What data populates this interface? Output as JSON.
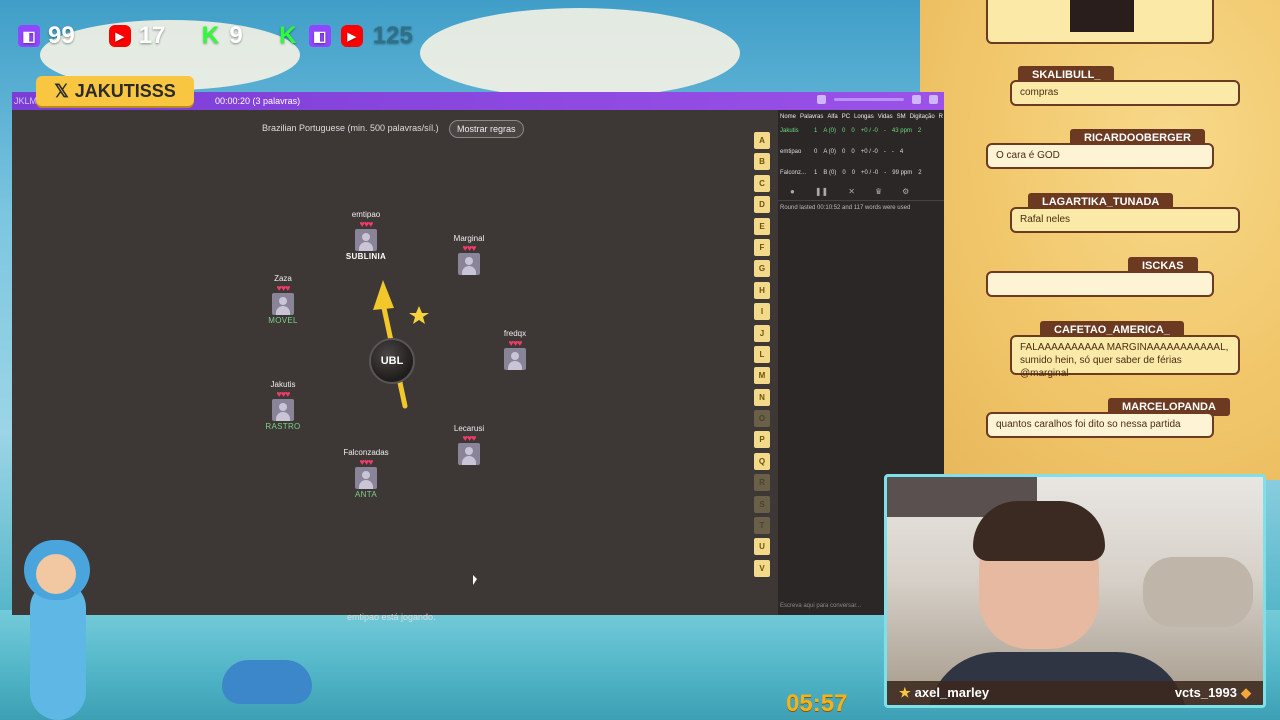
{
  "overlay": {
    "stats": [
      {
        "platform": "twitch-icon",
        "value": "99"
      },
      {
        "platform": "youtube-icon",
        "value": "17"
      },
      {
        "platform": "kick-icon",
        "value": "9"
      }
    ],
    "total": "125",
    "x_handle": "JAKUTISSS",
    "clock": "05:57"
  },
  "game": {
    "header_brand": "JKLM",
    "timer": "00:00:20 (3 palavras)",
    "language": "Brazilian Portuguese (min. 500 palavras/síl.)",
    "rules_button": "Mostrar regras",
    "bomb_syllable": "UBL",
    "status": "emtipao está jogando.",
    "players": [
      {
        "name": "emtipao",
        "word": "SUBLINIA",
        "active": true
      },
      {
        "name": "Marginal",
        "word": ""
      },
      {
        "name": "Zaza",
        "word": "MOVEL"
      },
      {
        "name": "fredqx",
        "word": ""
      },
      {
        "name": "Jakutis",
        "word": "RASTRO"
      },
      {
        "name": "Lecarusi",
        "word": ""
      },
      {
        "name": "Falconzadas",
        "word": "ANTA"
      }
    ],
    "hearts": "♥♥♥",
    "alphabet": [
      "A",
      "B",
      "C",
      "D",
      "E",
      "F",
      "G",
      "H",
      "I",
      "J",
      "L",
      "M",
      "N",
      "O",
      "P",
      "Q",
      "R",
      "S",
      "T",
      "U",
      "V"
    ],
    "dim_letters": [
      "O",
      "R",
      "S",
      "T"
    ]
  },
  "scoreboard": {
    "headers": [
      "Nome",
      "Palavras",
      "Alfa",
      "PC",
      "Longas",
      "Vidas",
      "SM",
      "Digitação",
      "R"
    ],
    "rows": [
      {
        "name": "Jakutis",
        "cols": [
          "1",
          "A (0)",
          "0",
          "0",
          "+0 / -0",
          "-",
          "43 ppm",
          "2"
        ]
      },
      {
        "name": "emtipao",
        "cols": [
          "0",
          "A (0)",
          "0",
          "0",
          "+0 / -0",
          "-",
          "-",
          "4"
        ]
      },
      {
        "name": "Falconz...",
        "cols": [
          "1",
          "B (0)",
          "0",
          "0",
          "+0 / -0",
          "-",
          "99 ppm",
          "2"
        ]
      }
    ],
    "chat_log": "Round lasted 00:10:52 and 117 words were used",
    "chat_placeholder": "Escreva aqui para conversar..."
  },
  "chat": [
    {
      "user": "SKALIBULL_",
      "message": "compras"
    },
    {
      "user": "RICARDOOBERGER",
      "message": "O cara é GOD"
    },
    {
      "user": "LAGARTIKA_TUNADA",
      "message": "Rafal neles"
    },
    {
      "user": "ISCKAS",
      "message": ""
    },
    {
      "user": "CAFETAO_AMERICA_",
      "message": "FALAAAAAAAAAA MARGINAAAAAAAAAAAL, sumido hein, só quer saber de férias @marginal"
    },
    {
      "user": "MARCELOPANDA",
      "message": "quantos caralhos foi dito so nessa partida"
    }
  ],
  "webcam": {
    "left_name": "axel_marley",
    "right_name": "vcts_1993"
  }
}
